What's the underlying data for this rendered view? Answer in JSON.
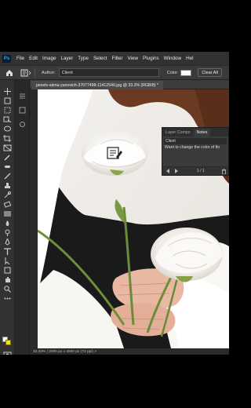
{
  "menu": {
    "logo": "Ps",
    "items": [
      "File",
      "Edit",
      "Image",
      "Layer",
      "Type",
      "Select",
      "Filter",
      "View",
      "Plugins",
      "Window",
      "Hel"
    ]
  },
  "options_bar": {
    "author_label": "Author:",
    "author_value": "Client",
    "color_label": "Color:",
    "color_value": "#ffffff",
    "clear_all_label": "Clear All"
  },
  "document": {
    "tab_title": "pexels-alena-yanovich-37077498-11412540.jpg @ 33.3% (RGB/8) *",
    "status": "33.33%   |   3000 px x 4500 px (72 ppi)   >"
  },
  "notes_panel": {
    "tabs": [
      "Layer Comps",
      "Notes"
    ],
    "active_tab": "Notes",
    "author": "Client",
    "note_text": "Want to change the color of flo",
    "pager": "1  /  1"
  },
  "colors": {
    "foreground": "#ffffff",
    "background": "#f2e500",
    "ui_dark": "#323232"
  },
  "icons": [
    "home-icon",
    "note-tool-icon",
    "note-icon",
    "trash-icon",
    "prev-icon",
    "next-icon"
  ]
}
